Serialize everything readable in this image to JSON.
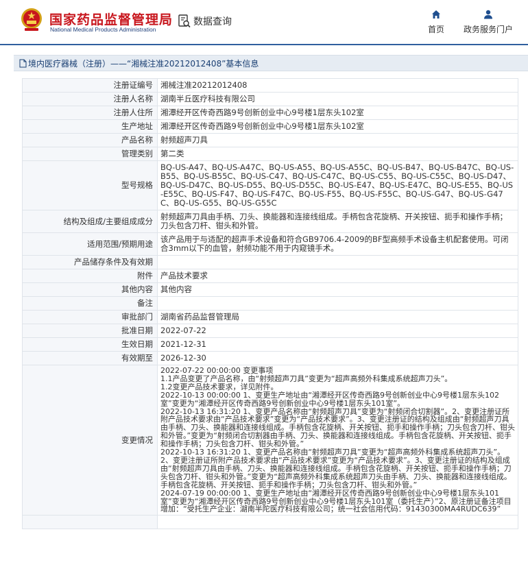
{
  "header": {
    "logo_cn": "国家药品监督管理局",
    "logo_en": "National Medical Products Administration",
    "search_label": "数据查询",
    "nav": [
      {
        "label": "首页",
        "icon": "home-icon"
      },
      {
        "label": "政务服务门户",
        "icon": "user-icon"
      }
    ],
    "colors": {
      "brand_red": "#c8161d",
      "brand_blue": "#1f3f7a",
      "accent": "#2f5f9e"
    }
  },
  "title_bar": {
    "text": "境内医疗器械（注册）——“湘械注准20212012408”基本信息",
    "icon": "document-icon"
  },
  "rows": [
    {
      "label": "注册证编号",
      "value": "湘械注准20212012408"
    },
    {
      "label": "注册人名称",
      "value": "湖南半丘医疗科技有限公司"
    },
    {
      "label": "注册人住所",
      "value": "湘潭经开区传奇西路9号创新创业中心9号楼1层东头102室"
    },
    {
      "label": "生产地址",
      "value": "湘潭经开区传奇西路9号创新创业中心9号楼1层东头102室"
    },
    {
      "label": "产品名称",
      "value": "射频超声刀具"
    },
    {
      "label": "管理类别",
      "value": "第二类"
    },
    {
      "label": "型号规格",
      "value": "BQ-US-A47、BQ-US-A47C、BQ-US-A55、BQ-US-A55C、BQ-US-B47、BQ-US-B47C、BQ-US-B55、BQ-US-B55C、BQ-US-C47、BQ-US-C47C、BQ-US-C55、BQ-US-C55C、BQ-US-D47、BQ-US-D47C、BQ-US-D55、BQ-US-D55C、BQ-US-E47、BQ-US-E47C、BQ-US-E55、BQ-US-E55C、BQ-US-F47、BQ-US-F47C、BQ-US-F55、BQ-US-F55C、BQ-US-G47、BQ-US-G47C、BQ-US-G55、BQ-US-G55C"
    },
    {
      "label": "结构及组成/主要组成成分",
      "value": "射频超声刀具由手柄、刀头、换能器和连接线组成。手柄包含花旋柄、开关按钮、扼手和操作手柄；刀头包含刀杆、钳头和外管。"
    },
    {
      "label": "适用范围/预期用途",
      "value": "该产品用于与适配的超声手术设备和符合GB9706.4-2009的BF型高频手术设备主机配套使用。可闭合3mm以下的血管，射频功能不用于内窥镜手术。"
    },
    {
      "label": "产品储存条件及有效期",
      "value": ""
    },
    {
      "label": "附件",
      "value": "产品技术要求"
    },
    {
      "label": "其他内容",
      "value": "其他内容"
    },
    {
      "label": "备注",
      "value": ""
    },
    {
      "label": "审批部门",
      "value": "湖南省药品监督管理局"
    },
    {
      "label": "批准日期",
      "value": "2022-07-22"
    },
    {
      "label": "生效日期",
      "value": "2021-12-31"
    },
    {
      "label": "有效期至",
      "value": "2026-12-30"
    },
    {
      "label": "变更情况",
      "value": "2022-07-22 00:00:00 变更事项\n 1.1产品变更了产品名称，由“射频超声刀具”变更为“超声高频外科集成系统超声刀头”。\n 1.2变更产品技术要求，详见附件。\n2022-10-13 00:00:00 1、变更生产地址由“湘潭经开区传奇西路9号创新创业中心9号楼1层东头102室”变更为“湘潭经开区传奇西路9号创新创业中心9号楼1层东头101室”。\n2022-10-13 16:31:20 1、变更产品名称由“射频超声刀具”变更为“射频闭合切割器”。2、变更注册证所附产品技术要求由“产品技术要求”变更为“产品技术要求”。3、变更注册证的结构及组成由“射频超声刀具由手柄、刀头、换能器和连接线组成。手柄包含花旋柄、开关按钮、扼手和操作手柄；刀头包含刀杆、钳头和外管。”变更为“射频闭合切割器由手柄、刀头、换能器和连接线组成。手柄包含花旋柄、开关按钮、扼手和操作手柄；刀头包含刀杆、钳头和外管。”\n2022-10-13 16:31:20 1、变更产品名称由“射频超声刀具”变更为“超声高频外科集成系统超声刀头”。2、变更注册证所附产品技术要求由“产品技术要求”变更为“产品技术要求”。3、变更注册证的结构及组成由“射频超声刀具由手柄、刀头、换能器和连接线组成。手柄包含花旋柄、开关按钮、扼手和操作手柄；刀头包含刀杆、钳头和外管。”变更为“超声高频外科集成系统超声刀头由手柄、刀头、换能器和连接线组成。手柄包含花旋柄、开关按钮、扼手和操作手柄；刀头包含刀杆、钳头和外管。”\n2024-07-19 00:00:00 1、变更生产地址由“湘潭经开区传奇西路9号创新创业中心9号楼1层东头101室”变更为“湘潭经开区传奇西路9号创新创业中心9号楼1层东头101室（委托生产）”2、原注册证备注项目增加：“受托生产企业：湖南半陀医疗科技有限公司；统一社会信用代码：91430300MA4RUDC639”"
    }
  ]
}
